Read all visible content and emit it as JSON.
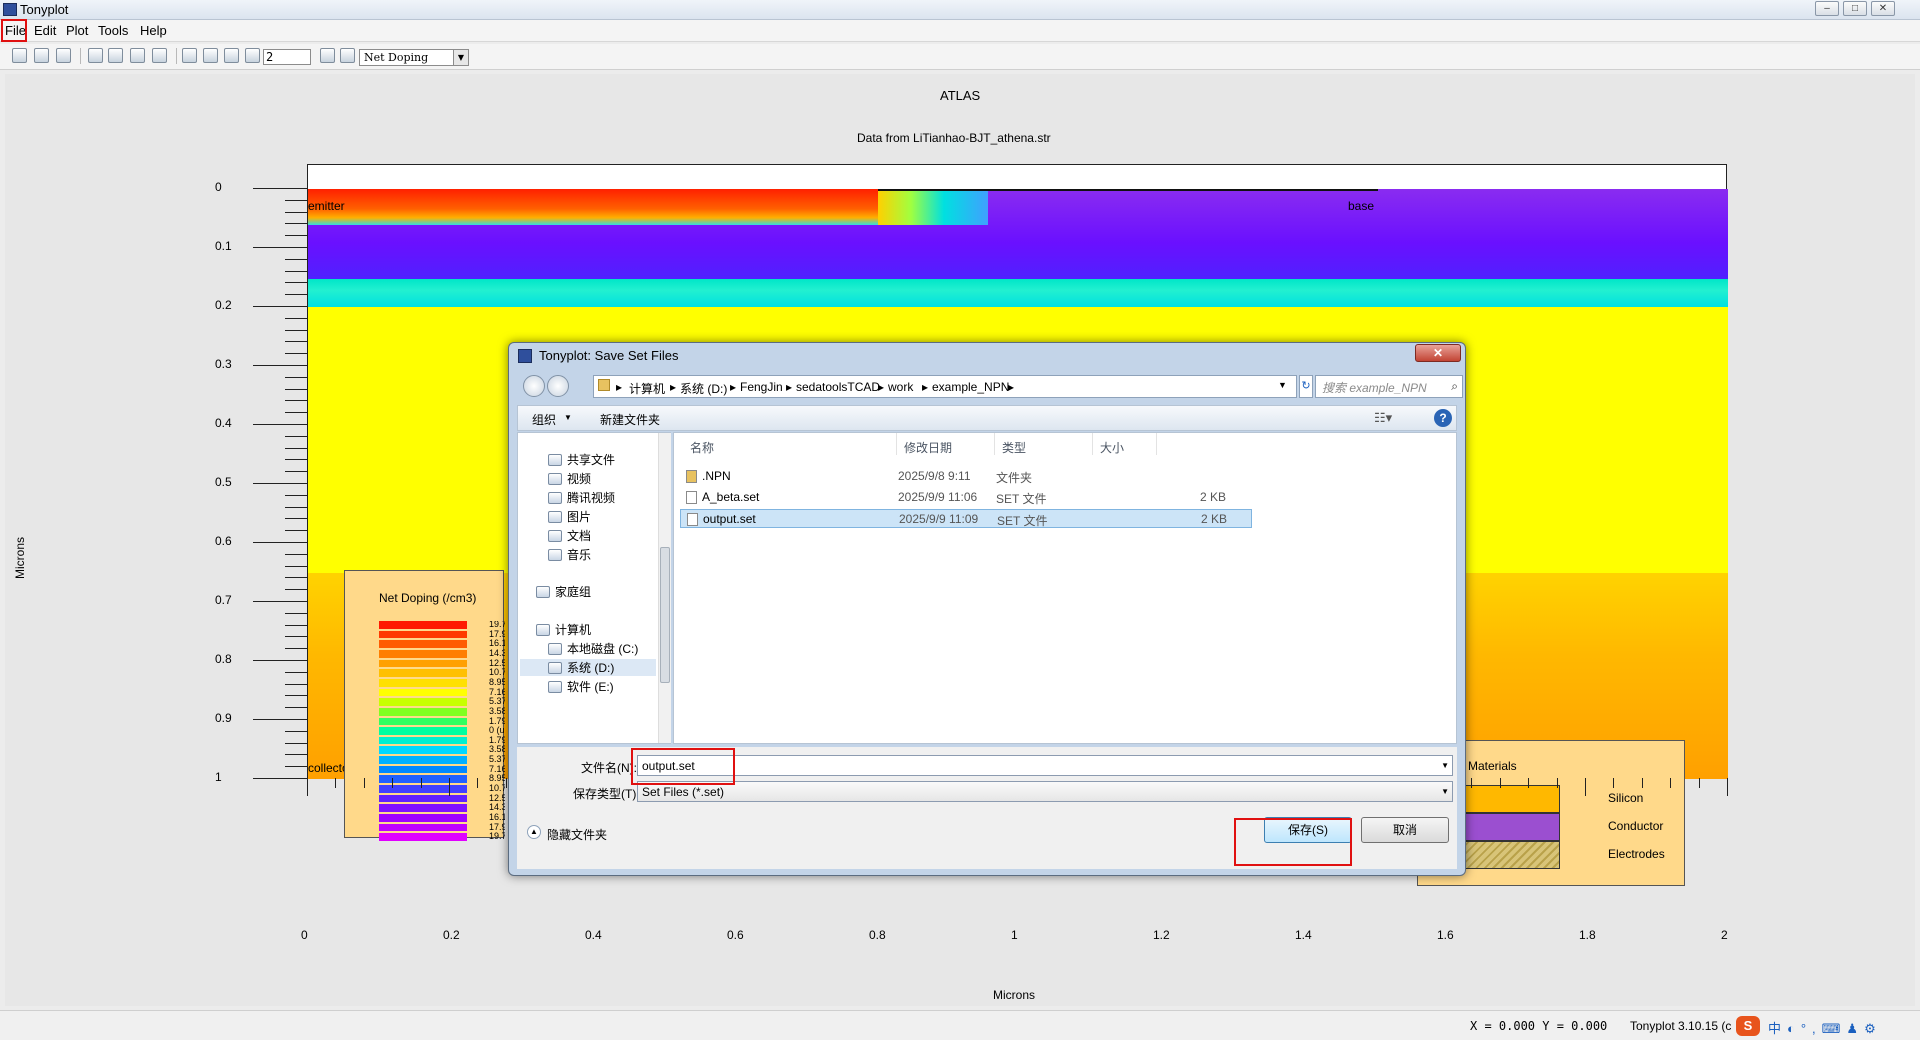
{
  "window": {
    "title": "Tonyplot"
  },
  "menu": [
    "File",
    "Edit",
    "Plot",
    "Tools",
    "Help"
  ],
  "toolbar": {
    "zoom_value": "2",
    "plot_type": "Net Doping"
  },
  "plot": {
    "title": "ATLAS",
    "subtitle": "Data from LiTianhao-BJT_athena.str",
    "xlabel": "Microns",
    "ylabel": "Microns",
    "x_ticks": [
      "0",
      "0.2",
      "0.4",
      "0.6",
      "0.8",
      "1",
      "1.2",
      "1.4",
      "1.6",
      "1.8",
      "2"
    ],
    "y_ticks": [
      "0",
      "0.1",
      "0.2",
      "0.3",
      "0.4",
      "0.5",
      "0.6",
      "0.7",
      "0.8",
      "0.9",
      "1"
    ],
    "electrodes": [
      "emitter",
      "base",
      "collector"
    ],
    "legend_title": "Net Doping (/cm3)",
    "legend_values": [
      "19.7",
      "17.9",
      "16.1",
      "14.3",
      "12.5",
      "10.7",
      "8.95",
      "7.16",
      "5.37",
      "3.58",
      "1.79",
      "0 (ui",
      "1.79",
      "3.58",
      "5.37",
      "7.16",
      "8.95",
      "10.7",
      "12.5",
      "14.3",
      "16.1",
      "17.9",
      "19.7"
    ],
    "materials_title": "Materials",
    "materials": [
      {
        "name": "Silicon",
        "color": "#ffb800"
      },
      {
        "name": "Conductor",
        "color": "#9b4fd0"
      },
      {
        "name": "Electrodes",
        "color": "#d8c478"
      }
    ]
  },
  "status": {
    "coords": "X = 0.000 Y = 0.000",
    "version": "Tonyplot 3.10.15 (c"
  },
  "dialog": {
    "title": "Tonyplot: Save Set Files",
    "breadcrumbs": [
      "计算机",
      "系统 (D:)",
      "FengJin",
      "sedatoolsTCAD",
      "work",
      "example_NPN"
    ],
    "search_placeholder": "搜索 example_NPN",
    "organize": "组织",
    "new_folder": "新建文件夹",
    "nav_items": [
      {
        "label": "共享文件",
        "icon": "shared-folder-icon"
      },
      {
        "label": "视频",
        "icon": "video-icon"
      },
      {
        "label": "腾讯视频",
        "icon": "tencent-video-icon"
      },
      {
        "label": "图片",
        "icon": "picture-icon"
      },
      {
        "label": "文档",
        "icon": "document-icon"
      },
      {
        "label": "音乐",
        "icon": "music-icon"
      },
      {
        "label": "家庭组",
        "icon": "homegroup-icon"
      },
      {
        "label": "计算机",
        "icon": "computer-icon"
      },
      {
        "label": "本地磁盘 (C:)",
        "icon": "drive-icon"
      },
      {
        "label": "系统 (D:)",
        "icon": "drive-icon"
      },
      {
        "label": "软件 (E:)",
        "icon": "drive-icon"
      }
    ],
    "columns": [
      "名称",
      "修改日期",
      "类型",
      "大小"
    ],
    "files": [
      {
        "name": ".NPN",
        "date": "2025/9/8 9:11",
        "type": "文件夹",
        "size": ""
      },
      {
        "name": "A_beta.set",
        "date": "2025/9/9 11:06",
        "type": "SET 文件",
        "size": "2 KB"
      },
      {
        "name": "output.set",
        "date": "2025/9/9 11:09",
        "type": "SET 文件",
        "size": "2 KB"
      }
    ],
    "filename_label": "文件名(N):",
    "filename_value": "output.set",
    "filetype_label": "保存类型(T):",
    "filetype_value": "Set Files (*.set)",
    "hide_folders": "隐藏文件夹",
    "save_button": "保存(S)",
    "cancel_button": "取消"
  }
}
